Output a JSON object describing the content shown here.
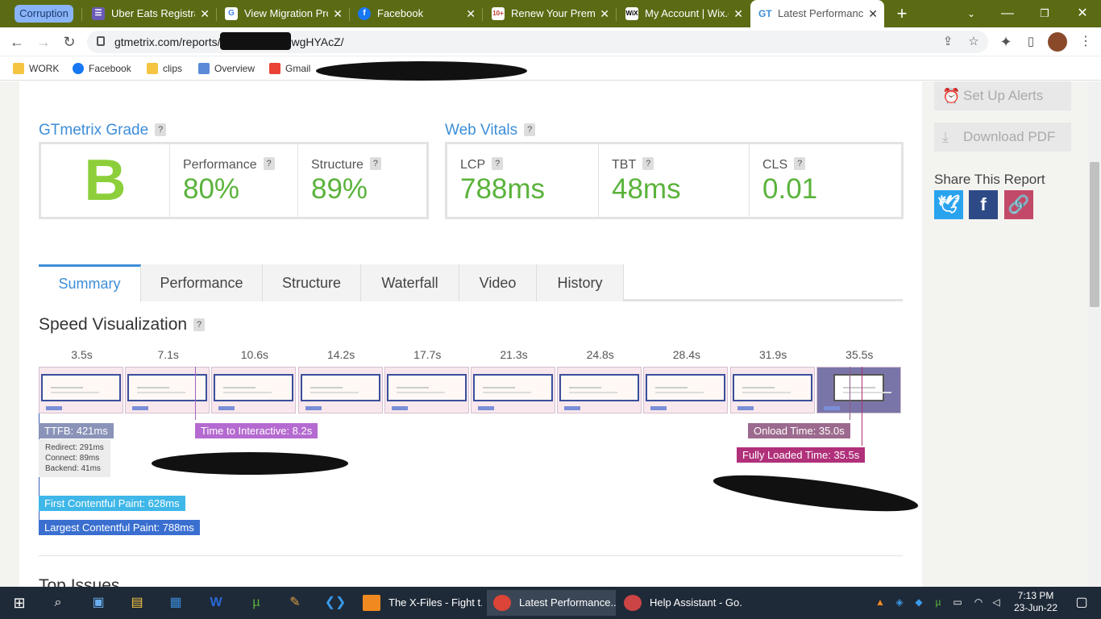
{
  "browser": {
    "group_label": "Corruption",
    "tabs": [
      {
        "title": "Uber Eats Registrat",
        "icon": "uber-eats-icon",
        "color": "#4a3a8a"
      },
      {
        "title": "View Migration Pro",
        "icon": "google-icon",
        "color": "#ffffff"
      },
      {
        "title": "Facebook",
        "icon": "facebook-icon",
        "color": "#1877f2"
      },
      {
        "title": "Renew Your Premiu",
        "icon": "premium-icon",
        "color": "#c0392b"
      },
      {
        "title": "My Account | Wix.c",
        "icon": "wix-icon",
        "color": "#ffffff"
      },
      {
        "title": "Latest Performance",
        "icon": "gtmetrix-icon",
        "color": "#3d8ed8"
      }
    ],
    "url": "gtmetrix.com/reports/",
    "url_tail": "wgHYAcZ/",
    "bookmarks": [
      "WORK",
      "Facebook",
      "clips",
      "Overview",
      "Gmail"
    ]
  },
  "report": {
    "grade_title": "GTmetrix Grade",
    "grade_letter": "B",
    "performance_label": "Performance",
    "performance_value": "80%",
    "structure_label": "Structure",
    "structure_value": "89%",
    "vitals_title": "Web Vitals",
    "lcp_label": "LCP",
    "lcp_value": "788ms",
    "tbt_label": "TBT",
    "tbt_value": "48ms",
    "cls_label": "CLS",
    "cls_value": "0.01",
    "help": "?"
  },
  "tabs": [
    "Summary",
    "Performance",
    "Structure",
    "Waterfall",
    "Video",
    "History"
  ],
  "speed": {
    "title": "Speed Visualization",
    "ticks": [
      "3.5s",
      "7.1s",
      "10.6s",
      "14.2s",
      "17.7s",
      "21.3s",
      "24.8s",
      "28.4s",
      "31.9s",
      "35.5s"
    ],
    "ttfb": "TTFB: 421ms",
    "redirect": "Redirect: 291ms",
    "connect": "Connect: 89ms",
    "backend": "Backend: 41ms",
    "tti": "Time to Interactive: 8.2s",
    "onload": "Onload Time: 35.0s",
    "fully": "Fully Loaded Time: 35.5s",
    "fcp": "First Contentful Paint: 628ms",
    "lcp": "Largest Contentful Paint: 788ms",
    "next_section": "Top Issues"
  },
  "sidebar": {
    "alerts": "Set Up Alerts",
    "pdf": "Download PDF",
    "share_title": "Share This Report"
  },
  "taskbar": {
    "vlc": "The X-Files - Fight t...",
    "chrome": "Latest Performance...",
    "help": "Help Assistant - Go...",
    "time": "7:13 PM",
    "date": "23-Jun-22"
  }
}
